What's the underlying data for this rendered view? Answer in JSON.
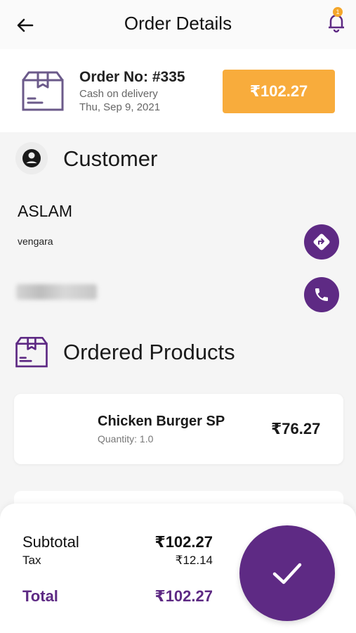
{
  "app_bar": {
    "title": "Order Details",
    "notification_count": "1"
  },
  "order": {
    "number": "Order No: #335",
    "payment_method": "Cash on delivery",
    "date": "Thu, Sep 9, 2021",
    "amount": "₹102.27"
  },
  "customer": {
    "section_title": "Customer",
    "name": "ASLAM",
    "address": "vengara",
    "phone": "9876543210"
  },
  "products": {
    "section_title": "Ordered Products",
    "items": [
      {
        "name": "Chicken Burger SP",
        "quantity": "Quantity: 1.0",
        "price": "₹76.27"
      }
    ]
  },
  "summary": {
    "subtotal_label": "Subtotal",
    "subtotal_value": "₹102.27",
    "tax_label": "Tax",
    "tax_value": "₹12.14",
    "total_label": "Total",
    "total_value": "₹102.27"
  },
  "colors": {
    "primary": "#5e2a84",
    "accent": "#f8ac3c",
    "badge": "#f4a62a"
  },
  "icons": {
    "back": "arrow-left-icon",
    "bell": "bell-icon",
    "order": "package-box-icon",
    "customer": "account-circle-icon",
    "directions": "directions-icon",
    "phone": "phone-icon",
    "confirm": "checkmark-icon"
  }
}
